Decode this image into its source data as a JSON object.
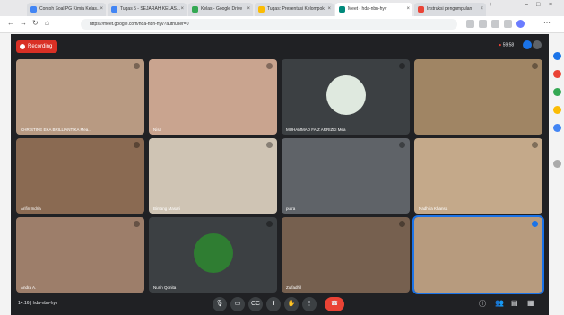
{
  "browser": {
    "tabs": [
      {
        "label": "Contoh Soal PG Kimia Kelas...",
        "fav": "#4285f4"
      },
      {
        "label": "Tugas 5 - SEJARAH KELAS...",
        "fav": "#4285f4"
      },
      {
        "label": "Kelas - Google Drive",
        "fav": "#34a853"
      },
      {
        "label": "Tugas: Presentasi Kelompok",
        "fav": "#fbbc04"
      },
      {
        "label": "Meet - hda-nbn-hyv",
        "fav": "#00897b"
      },
      {
        "label": "Instruksi pengumpulan",
        "fav": "#ea4335"
      }
    ],
    "url": "https://meet.google.com/hda-nbn-hyv?authuser=0",
    "new_tab_glyph": "+"
  },
  "meet": {
    "recording_label": "Recording",
    "timer": "59:58",
    "colors": {
      "bg": "#202124",
      "tile": "#3c4043",
      "end": "#ea4335",
      "rec": "#d93025"
    },
    "participants": [
      {
        "name": "CHRISTINE EKA BRILLIANTIKA Mea...",
        "bg": "#b89a82"
      },
      {
        "name": "Nisa",
        "bg": "#c9a48f"
      },
      {
        "name": "MUHAMMAD FAIZ ARRIZKI Mea",
        "bg": "#3c4043",
        "avatar": "#dfe9df"
      },
      {
        "name": "",
        "bg": "#a08564"
      },
      {
        "name": "Arifin Indria",
        "bg": "#8a6a52"
      },
      {
        "name": "Bintang Masari",
        "bg": "#cfc4b4"
      },
      {
        "name": "putra",
        "bg": "#5f6368"
      },
      {
        "name": "Nadhira Khansa",
        "bg": "#c4a98a"
      },
      {
        "name": "Andra A.",
        "bg": "#9d7e6a"
      },
      {
        "name": "Nurin Qonita",
        "bg": "#3c4043",
        "avatar": "#2f7d32"
      },
      {
        "name": "Zulfadhil",
        "bg": "#76604f"
      },
      {
        "name": "",
        "bg": "#b79b7e"
      }
    ],
    "footer": {
      "clock": "14:16",
      "meeting_code": "hda-nbn-hyv",
      "separator": "|",
      "end_icon": "phone-hangup-icon"
    }
  }
}
